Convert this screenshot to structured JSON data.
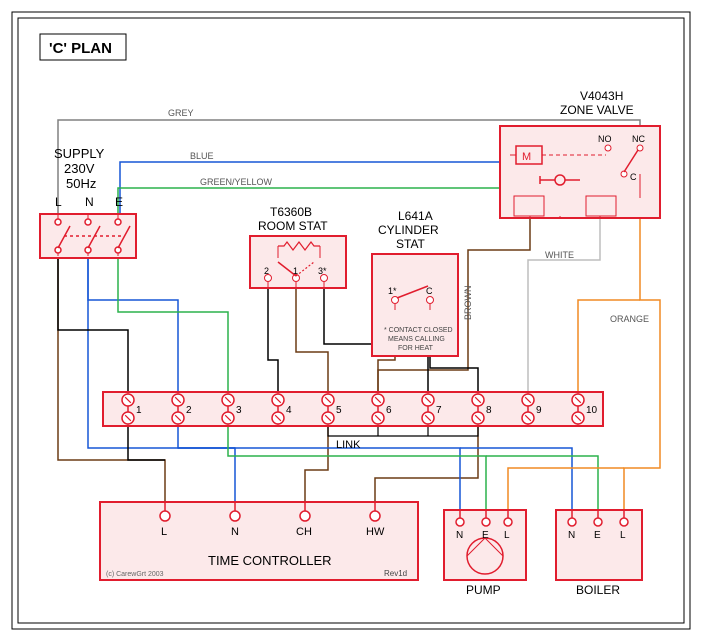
{
  "title": "'C' PLAN",
  "supply": {
    "label": "SUPPLY",
    "voltage": "230V",
    "frequency": "50Hz",
    "terminals": [
      "L",
      "N",
      "E"
    ]
  },
  "zone_valve": {
    "model": "V4043H",
    "label": "ZONE VALVE",
    "motor": "M",
    "nc": "NC",
    "no": "NO",
    "c": "C"
  },
  "room_stat": {
    "model": "T6360B",
    "label": "ROOM STAT",
    "terminals": [
      "2",
      "1",
      "3*"
    ]
  },
  "cyl_stat": {
    "model": "L641A",
    "label1": "CYLINDER",
    "label2": "STAT",
    "terminals": [
      "1*",
      "C"
    ],
    "note1": "* CONTACT CLOSED",
    "note2": "MEANS CALLING",
    "note3": "FOR HEAT"
  },
  "junction": {
    "terminals": [
      "1",
      "2",
      "3",
      "4",
      "5",
      "6",
      "7",
      "8",
      "9",
      "10"
    ],
    "link": "LINK"
  },
  "time_controller": {
    "label": "TIME CONTROLLER",
    "terminals": [
      "L",
      "N",
      "CH",
      "HW"
    ],
    "rev": "Rev1d",
    "copyright": "(c) CarewGrt 2003"
  },
  "pump": {
    "label": "PUMP",
    "terminals": [
      "N",
      "E",
      "L"
    ]
  },
  "boiler": {
    "label": "BOILER",
    "terminals": [
      "N",
      "E",
      "L"
    ]
  },
  "wire_labels": {
    "grey": "GREY",
    "blue": "BLUE",
    "green_yellow": "GREEN/YELLOW",
    "brown": "BROWN",
    "white": "WHITE",
    "orange": "ORANGE"
  },
  "colors": {
    "frame": "#E11D2E",
    "black": "#000000",
    "grey": "#808080",
    "blue": "#1757D6",
    "green": "#2BB24C",
    "brown": "#6B3B15",
    "orange": "#F08A24",
    "fill": "#FCE9EA"
  }
}
